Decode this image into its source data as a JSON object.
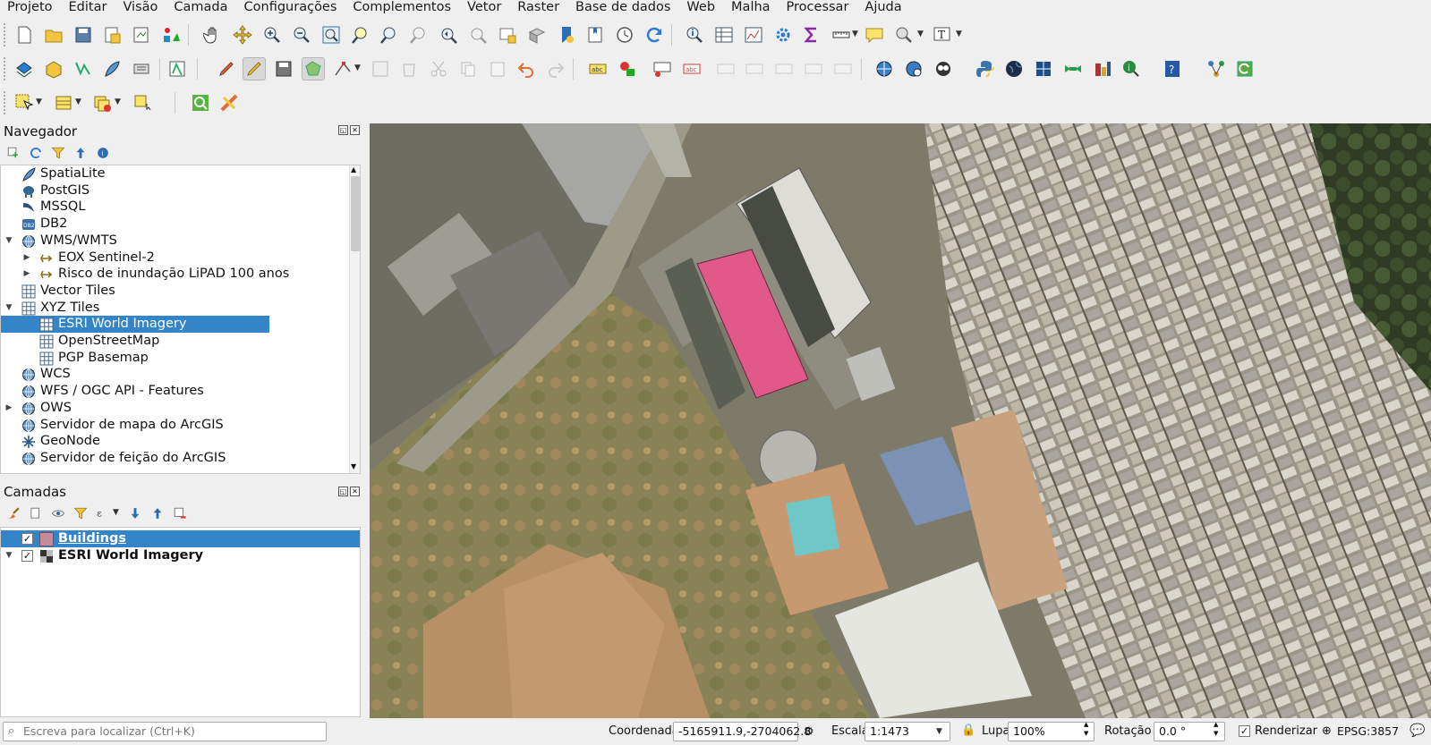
{
  "menu": [
    "Projeto",
    "Editar",
    "Visão",
    "Camada",
    "Configurações",
    "Complementos",
    "Vetor",
    "Raster",
    "Base de dados",
    "Web",
    "Malha",
    "Processar",
    "Ajuda"
  ],
  "browser": {
    "title": "Navegador",
    "items": [
      {
        "label": "SpatiaLite",
        "icon": "feather-icon",
        "level": 0,
        "arrow": ""
      },
      {
        "label": "PostGIS",
        "icon": "elephant-icon",
        "level": 0,
        "arrow": ""
      },
      {
        "label": "MSSQL",
        "icon": "mssql-icon",
        "level": 0,
        "arrow": ""
      },
      {
        "label": "DB2",
        "icon": "db2-icon",
        "level": 0,
        "arrow": ""
      },
      {
        "label": "WMS/WMTS",
        "icon": "globe-icon",
        "level": 0,
        "arrow": "expanded"
      },
      {
        "label": "EOX Sentinel-2",
        "icon": "wms-layer-icon",
        "level": 1,
        "arrow": "collapsed"
      },
      {
        "label": "Risco de inundação LiPAD 100 anos",
        "icon": "wms-layer-icon",
        "level": 1,
        "arrow": "collapsed"
      },
      {
        "label": "Vector Tiles",
        "icon": "grid-icon",
        "level": 0,
        "arrow": ""
      },
      {
        "label": "XYZ Tiles",
        "icon": "grid-icon",
        "level": 0,
        "arrow": "expanded"
      },
      {
        "label": "ESRI World Imagery",
        "icon": "grid-icon",
        "level": 1,
        "arrow": "",
        "selected": true
      },
      {
        "label": "OpenStreetMap",
        "icon": "grid-icon",
        "level": 1,
        "arrow": ""
      },
      {
        "label": "PGP Basemap",
        "icon": "grid-icon",
        "level": 1,
        "arrow": ""
      },
      {
        "label": "WCS",
        "icon": "globe-icon",
        "level": 0,
        "arrow": ""
      },
      {
        "label": "WFS / OGC API - Features",
        "icon": "globe-icon",
        "level": 0,
        "arrow": ""
      },
      {
        "label": "OWS",
        "icon": "globe-icon",
        "level": 0,
        "arrow": "collapsed"
      },
      {
        "label": "Servidor de mapa do ArcGIS",
        "icon": "globe-icon",
        "level": 0,
        "arrow": ""
      },
      {
        "label": "GeoNode",
        "icon": "geonode-icon",
        "level": 0,
        "arrow": ""
      },
      {
        "label": "Servidor de feição do ArcGIS",
        "icon": "globe-icon",
        "level": 0,
        "arrow": ""
      }
    ]
  },
  "layers": {
    "title": "Camadas",
    "items": [
      {
        "label": "Buildings",
        "checked": true,
        "selected": true
      },
      {
        "label": "ESRI World Imagery",
        "checked": true,
        "selected": false
      }
    ]
  },
  "status": {
    "locator_placeholder": "Escreva para localizar (Ctrl+K)",
    "coord_label": "Coordenada",
    "coord_value": "-5165911.9,-2704062.8",
    "scale_label": "Escala",
    "scale_value": "1:1473",
    "magnifier_label": "Lupa",
    "magnifier_value": "100%",
    "rotation_label": "Rotação",
    "rotation_value": "0.0 °",
    "render_label": "Renderizar",
    "crs": "EPSG:3857"
  },
  "colors": {
    "selection": "#3484c8",
    "building_fill": "#e15989"
  }
}
